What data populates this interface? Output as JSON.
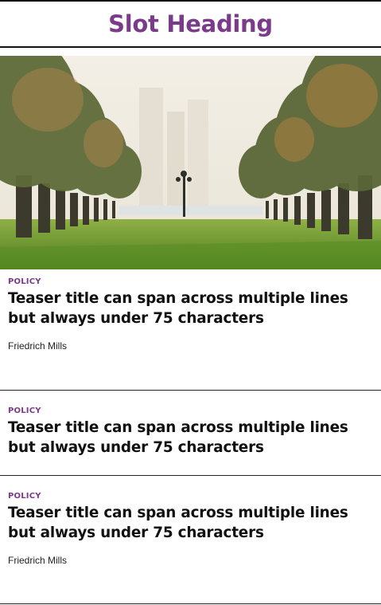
{
  "slot": {
    "heading": "Slot Heading"
  },
  "colors": {
    "accent": "#7b3b8b",
    "text": "#111111"
  },
  "teasers": [
    {
      "kicker": "POLICY",
      "title": "Teaser title can span across multiple lines but always under 75 characters",
      "author": "Friedrich Mills",
      "has_image": true
    },
    {
      "kicker": "POLICY",
      "title": "Teaser title can span across multiple lines but always under 75 characters"
    },
    {
      "kicker": "POLICY",
      "title": "Teaser title can span across multiple lines but always under 75 characters",
      "author": "Friedrich Mills"
    }
  ]
}
